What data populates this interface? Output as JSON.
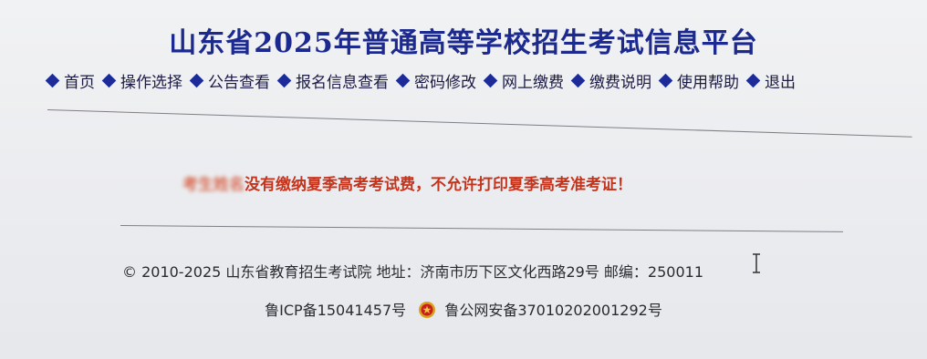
{
  "header": {
    "title": "山东省2025年普通高等学校招生考试信息平台"
  },
  "nav": {
    "items": [
      {
        "label": "首页"
      },
      {
        "label": "操作选择"
      },
      {
        "label": "公告查看"
      },
      {
        "label": "报名信息查看"
      },
      {
        "label": "密码修改"
      },
      {
        "label": "网上缴费"
      },
      {
        "label": "缴费说明"
      },
      {
        "label": "使用帮助"
      },
      {
        "label": "退出"
      }
    ]
  },
  "notice": {
    "name_blurred": "考生姓名",
    "message": "没有缴纳夏季高考考试费，不允许打印夏季高考准考证！"
  },
  "footer": {
    "copyright": "© 2010-2025 山东省教育招生考试院 地址：济南市历下区文化西路29号 邮编：250011",
    "icp": "鲁ICP备15041457号",
    "police_record": "鲁公网安备37010202001292号"
  },
  "colors": {
    "title": "#1c2a8f",
    "nav_diamond": "#1d2b99",
    "notice": "#c4341c"
  }
}
